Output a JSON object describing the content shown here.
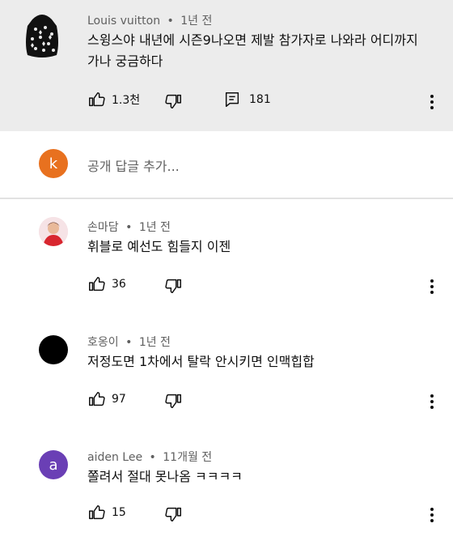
{
  "top_comment": {
    "author": "Louis vuitton",
    "separator": "•",
    "time": "1년 전",
    "text_line1": "스윙스야 내년에 시즌9나오면 제발 참가자로 나와라 어디까지",
    "text_line2": "가나 궁금하다",
    "likes": "1.3천",
    "replies": "181"
  },
  "add_reply": {
    "avatar_letter": "k",
    "placeholder": "공개 답글 추가..."
  },
  "replies": [
    {
      "author": "손마담",
      "separator": "•",
      "time": "1년 전",
      "text": "휘블로 예선도 힘들지 이젠",
      "likes": "36"
    },
    {
      "author": "호옹이",
      "separator": "•",
      "time": "1년 전",
      "text": "저정도면 1차에서 탈락 안시키면 인맥힙합",
      "likes": "97"
    },
    {
      "author": "aiden Lee",
      "separator": "•",
      "time": "11개월 전",
      "text": "쫄려서 절대 못나옴 ㅋㅋㅋㅋ",
      "likes": "15",
      "avatar_letter": "a"
    }
  ],
  "colors": {
    "top_bg": "#ececec",
    "k_avatar": "#e8711f",
    "a_avatar": "#6a3fb5",
    "meta": "#606060"
  }
}
